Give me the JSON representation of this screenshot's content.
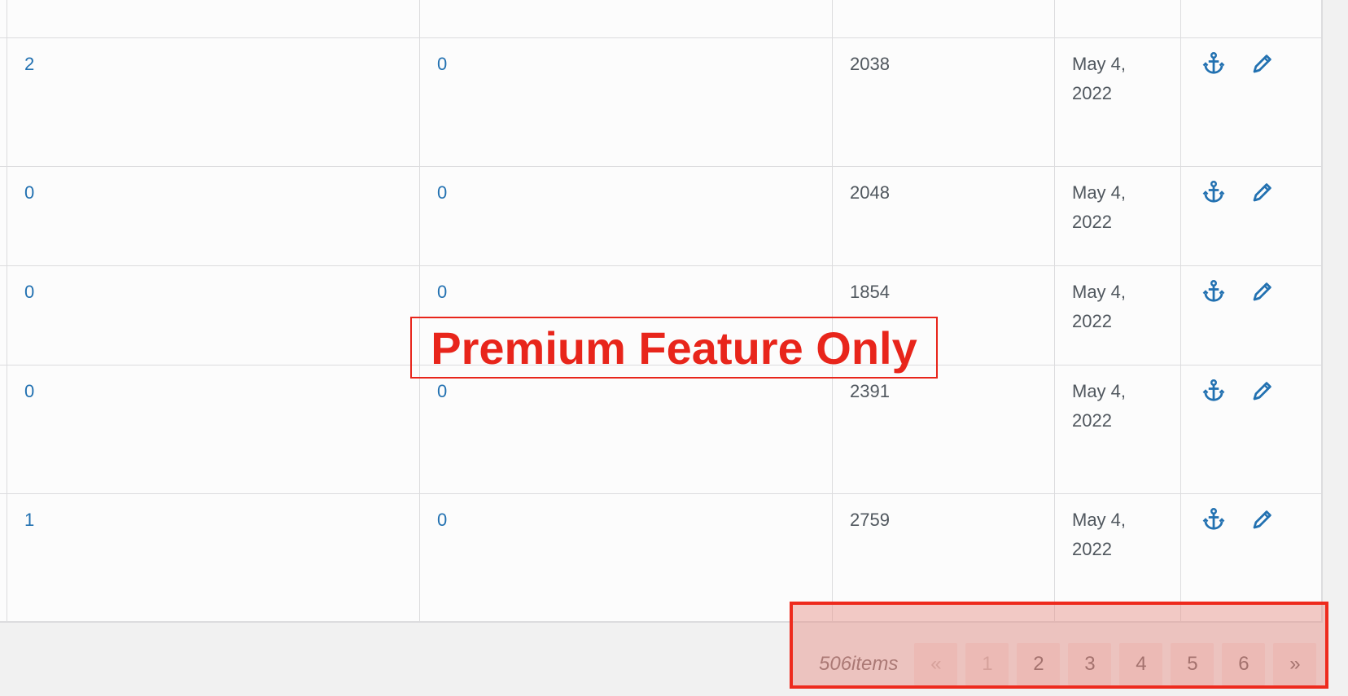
{
  "rows": [
    {
      "col1": "2",
      "col2": "0",
      "col3": "2038",
      "date": "May 4, 2022"
    },
    {
      "col1": "0",
      "col2": "0",
      "col3": "2048",
      "date": "May 4, 2022"
    },
    {
      "col1": "0",
      "col2": "0",
      "col3": "1854",
      "date": "May 4, 2022"
    },
    {
      "col1": "0",
      "col2": "0",
      "col3": "2391",
      "date": "May 4, 2022"
    },
    {
      "col1": "1",
      "col2": "0",
      "col3": "2759",
      "date": "May 4, 2022"
    }
  ],
  "icons": {
    "anchor": "anchor-icon",
    "edit": "pencil-icon"
  },
  "premium_label": "Premium Feature Only",
  "pagination": {
    "count": "506items",
    "first": "«",
    "pages": [
      "1",
      "2",
      "3",
      "4",
      "5",
      "6"
    ],
    "next": "»",
    "current_disabled": "1"
  },
  "colors": {
    "link": "#2271b1",
    "premium": "#e8251b",
    "icon": "#2271b1"
  }
}
